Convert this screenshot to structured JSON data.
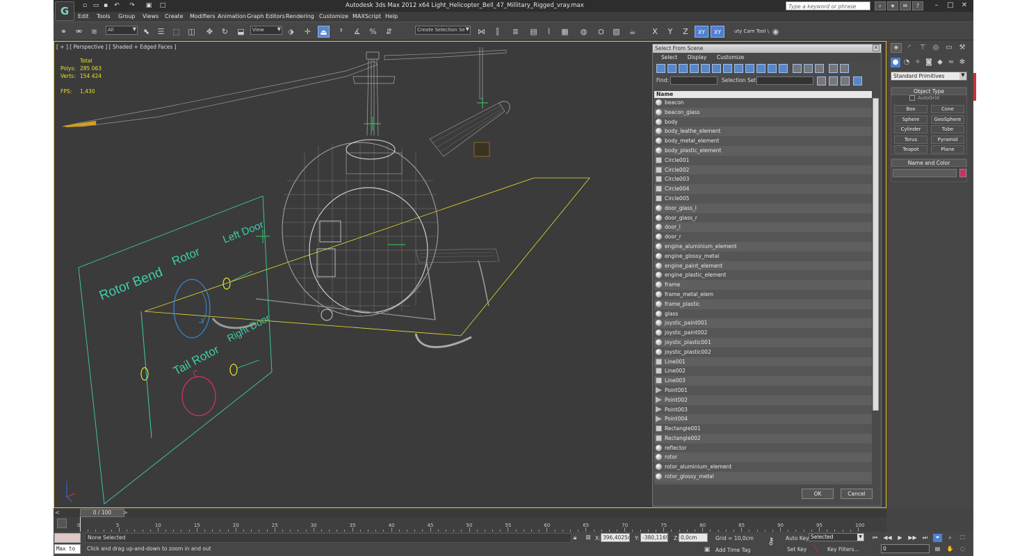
{
  "app": {
    "logo": "G",
    "title": "Autodesk 3ds Max  2012 x64     Light_Helicopter_Bell_47_Millitary_Rigged_vray.max",
    "search_placeholder": "Type a keyword or phrase"
  },
  "menu": [
    "Edit",
    "Tools",
    "Group",
    "Views",
    "Create",
    "Modifiers",
    "Animation",
    "Graph Editors",
    "Rendering",
    "Customize",
    "MAXScript",
    "Help"
  ],
  "toolbar": {
    "selection_filter": "All",
    "reference_coord": "View",
    "selection_set": "Create Selection Se",
    "axis_x": "X",
    "axis_y": "Y",
    "axis_z": "Z",
    "axis_xy": "XY",
    "axis_xy2": "XY",
    "custom_tool": "uty Cam Tool \\"
  },
  "viewport": {
    "label": "[ + ] [ Perspective ] [ Shaded + Edged Faces ]",
    "stats": {
      "total_label": "Total",
      "polys_label": "Polys:",
      "polys_value": "285 063",
      "verts_label": "Verts:",
      "verts_value": "154 424",
      "fps_label": "FPS:",
      "fps_value": "1,430"
    },
    "rig_labels": {
      "rotor_bend": "Rotor Bend",
      "rotor": "Rotor",
      "left_door": "Left Door",
      "right_door": "Right Door",
      "tail_rotor": "Tail Rotor"
    }
  },
  "dialog": {
    "title": "Select From Scene",
    "menu": [
      "Select",
      "Display",
      "Customize"
    ],
    "find_label": "Find:",
    "selection_set_label": "Selection Set:",
    "column_name": "Name",
    "ok": "OK",
    "cancel": "Cancel",
    "items": [
      {
        "name": "beacon",
        "type": "geo"
      },
      {
        "name": "beacon_glass",
        "type": "geo"
      },
      {
        "name": "body",
        "type": "geo"
      },
      {
        "name": "body_leathe_element",
        "type": "geo"
      },
      {
        "name": "body_metal_element",
        "type": "geo"
      },
      {
        "name": "body_plastic_element",
        "type": "geo"
      },
      {
        "name": "Circle001",
        "type": "shape"
      },
      {
        "name": "Circle002",
        "type": "shape"
      },
      {
        "name": "Circle003",
        "type": "shape"
      },
      {
        "name": "Circle004",
        "type": "shape"
      },
      {
        "name": "Circle005",
        "type": "shape"
      },
      {
        "name": "door_glass_l",
        "type": "geo"
      },
      {
        "name": "door_glass_r",
        "type": "geo"
      },
      {
        "name": "door_l",
        "type": "geo"
      },
      {
        "name": "door_r",
        "type": "geo"
      },
      {
        "name": "engine_aluminium_element",
        "type": "geo"
      },
      {
        "name": "engine_glossy_metal",
        "type": "geo"
      },
      {
        "name": "engine_paint_element",
        "type": "geo"
      },
      {
        "name": "engine_plastic_element",
        "type": "geo"
      },
      {
        "name": "frame",
        "type": "geo"
      },
      {
        "name": "frame_metal_elem",
        "type": "geo"
      },
      {
        "name": "frame_plastic",
        "type": "geo"
      },
      {
        "name": "glass",
        "type": "geo"
      },
      {
        "name": "joystic_paint001",
        "type": "geo"
      },
      {
        "name": "joystic_paint002",
        "type": "geo"
      },
      {
        "name": "joystic_plastic001",
        "type": "geo"
      },
      {
        "name": "joystic_plastic002",
        "type": "geo"
      },
      {
        "name": "Line001",
        "type": "shape"
      },
      {
        "name": "Line002",
        "type": "shape"
      },
      {
        "name": "Line003",
        "type": "shape"
      },
      {
        "name": "Point001",
        "type": "helper"
      },
      {
        "name": "Point002",
        "type": "helper"
      },
      {
        "name": "Point003",
        "type": "helper"
      },
      {
        "name": "Point004",
        "type": "helper"
      },
      {
        "name": "Rectangle001",
        "type": "shape"
      },
      {
        "name": "Rectangle002",
        "type": "shape"
      },
      {
        "name": "reflector",
        "type": "geo"
      },
      {
        "name": "rotor",
        "type": "geo"
      },
      {
        "name": "rotor_aluminium_element",
        "type": "geo"
      },
      {
        "name": "rotor_glossy_metal",
        "type": "geo"
      }
    ]
  },
  "command_panel": {
    "dropdown": "Standard Primitives",
    "object_type_title": "Object Type",
    "autogrid": "AutoGrid",
    "primitives": [
      "Box",
      "Cone",
      "Sphere",
      "GeoSphere",
      "Cylinder",
      "Tube",
      "Torus",
      "Pyramid",
      "Teapot",
      "Plane"
    ],
    "name_color_title": "Name and Color",
    "color": "#c8306a"
  },
  "timeline": {
    "frame_display": "0 / 100",
    "prev": "<",
    "next": ">",
    "ticks": [
      "0",
      "5",
      "10",
      "15",
      "20",
      "25",
      "30",
      "35",
      "40",
      "45",
      "50",
      "55",
      "60",
      "65",
      "70",
      "75",
      "80",
      "85",
      "90",
      "95",
      "100"
    ]
  },
  "status": {
    "maxscript": "Max to",
    "selection": "None Selected",
    "prompt": "Click and drag up-and-down to zoom in and out",
    "x_label": "X:",
    "x_value": "396,4025c",
    "y_label": "Y:",
    "y_value": "-380,1169(",
    "z_label": "Z:",
    "z_value": "0,0cm",
    "grid": "Grid = 10,0cm",
    "add_time_tag": "Add Time Tag",
    "auto_key": "Auto Key",
    "set_key": "Set Key",
    "key_mode": "Selected",
    "key_filters": "Key Filters...",
    "frame": "0"
  }
}
